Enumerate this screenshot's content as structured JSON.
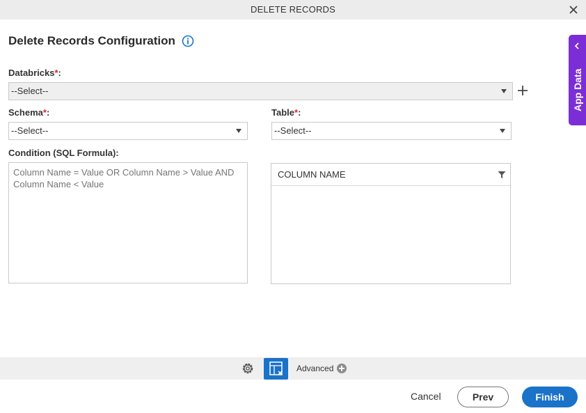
{
  "dialog": {
    "title": "DELETE RECORDS",
    "close_icon": "close-icon"
  },
  "form": {
    "heading": "Delete Records Configuration",
    "info_icon": "info-icon",
    "databricks": {
      "label": "Databricks",
      "required_mark": "*",
      "colon": ":",
      "selected": "--Select--"
    },
    "schema": {
      "label": "Schema",
      "required_mark": "*",
      "colon": ":",
      "selected": "--Select--"
    },
    "table": {
      "label": "Table",
      "required_mark": "*",
      "colon": ":",
      "selected": "--Select--"
    },
    "condition": {
      "label": "Condition (SQL Formula):",
      "placeholder": "Column Name = Value OR Column Name > Value AND Column Name < Value",
      "value": ""
    },
    "columns_grid": {
      "header": "COLUMN NAME",
      "rows": []
    }
  },
  "side_panel": {
    "label": "App Data",
    "icon": "chevron-left-icon"
  },
  "toolbar": {
    "advanced_label": "Advanced",
    "settings_icon": "gear-icon",
    "active_tool_icon": "delete-records-icon"
  },
  "footer": {
    "cancel": "Cancel",
    "prev": "Prev",
    "finish": "Finish"
  },
  "colors": {
    "accent": "#1a72c9",
    "side_panel": "#7b2ed6",
    "required": "#d9262e"
  }
}
